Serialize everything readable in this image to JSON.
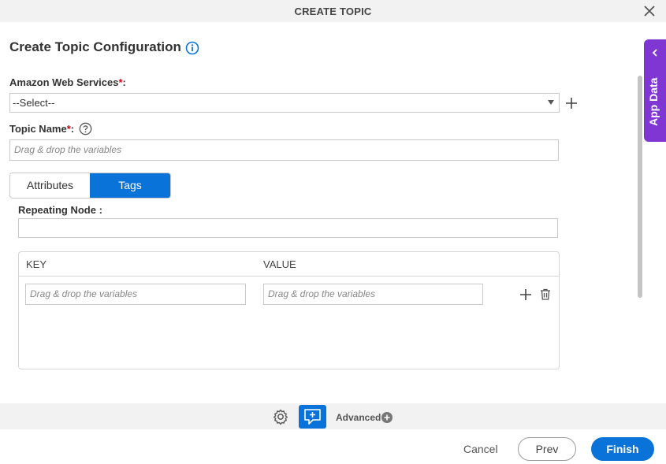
{
  "window": {
    "title": "CREATE TOPIC"
  },
  "heading": "Create Topic Configuration",
  "aws": {
    "label": "Amazon Web Services",
    "required_mark": "*",
    "suffix": ":",
    "selected": "--Select--"
  },
  "topic_name": {
    "label": "Topic Name",
    "required_mark": "*",
    "suffix": ":",
    "placeholder": "Drag & drop the variables"
  },
  "tabs": [
    {
      "label": "Attributes",
      "active": false
    },
    {
      "label": "Tags",
      "active": true
    }
  ],
  "repeating_node": {
    "label": "Repeating Node :",
    "value": ""
  },
  "grid": {
    "columns": [
      "KEY",
      "VALUE"
    ],
    "rows": [
      {
        "key_placeholder": "Drag & drop the variables",
        "value_placeholder": "Drag & drop the variables"
      }
    ]
  },
  "side_panel": {
    "label": "App Data"
  },
  "toolbar": {
    "advanced_label": "Advanced"
  },
  "footer": {
    "cancel": "Cancel",
    "prev": "Prev",
    "finish": "Finish"
  },
  "colors": {
    "accent": "#0a73d9",
    "side_panel": "#7f36d3",
    "required": "#d0021b"
  }
}
